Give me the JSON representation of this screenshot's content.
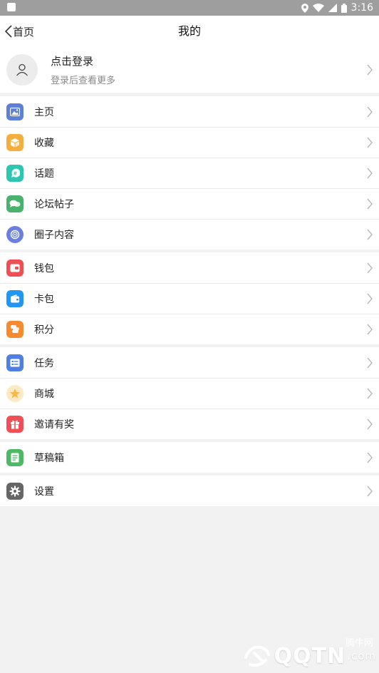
{
  "status_bar": {
    "time": "3:16"
  },
  "nav": {
    "back_label": "首页",
    "title": "我的"
  },
  "login": {
    "title": "点击登录",
    "subtitle": "登录后查看更多"
  },
  "groups": [
    {
      "items": [
        {
          "label": "主页",
          "icon": "image-icon",
          "color": "#5d7fd6"
        },
        {
          "label": "收藏",
          "icon": "box-icon",
          "color": "#f5ad3b"
        },
        {
          "label": "话题",
          "icon": "hashtag-icon",
          "color": "#2dc6b0"
        },
        {
          "label": "论坛帖子",
          "icon": "chat-icon",
          "color": "#49b36e"
        },
        {
          "label": "圈子内容",
          "icon": "circle-icon",
          "color": "#6a7fe0"
        }
      ]
    },
    {
      "items": [
        {
          "label": "钱包",
          "icon": "wallet-icon",
          "color": "#ef4f52"
        },
        {
          "label": "卡包",
          "icon": "card-icon",
          "color": "#2196f3"
        },
        {
          "label": "积分",
          "icon": "coins-icon",
          "color": "#f78a2c"
        }
      ]
    },
    {
      "items": [
        {
          "label": "任务",
          "icon": "task-icon",
          "color": "#4f7fe0"
        },
        {
          "label": "商城",
          "icon": "star-icon",
          "color": "#f6c66b"
        },
        {
          "label": "邀请有奖",
          "icon": "gift-icon",
          "color": "#ef4f55"
        }
      ]
    },
    {
      "items": [
        {
          "label": "草稿箱",
          "icon": "draft-icon",
          "color": "#4db865"
        }
      ]
    },
    {
      "items": [
        {
          "label": "设置",
          "icon": "gear-icon",
          "color": "#666666"
        }
      ]
    }
  ],
  "watermark": {
    "brand": "QQTN",
    "domain": ".com",
    "tagline": "腾牛网"
  }
}
